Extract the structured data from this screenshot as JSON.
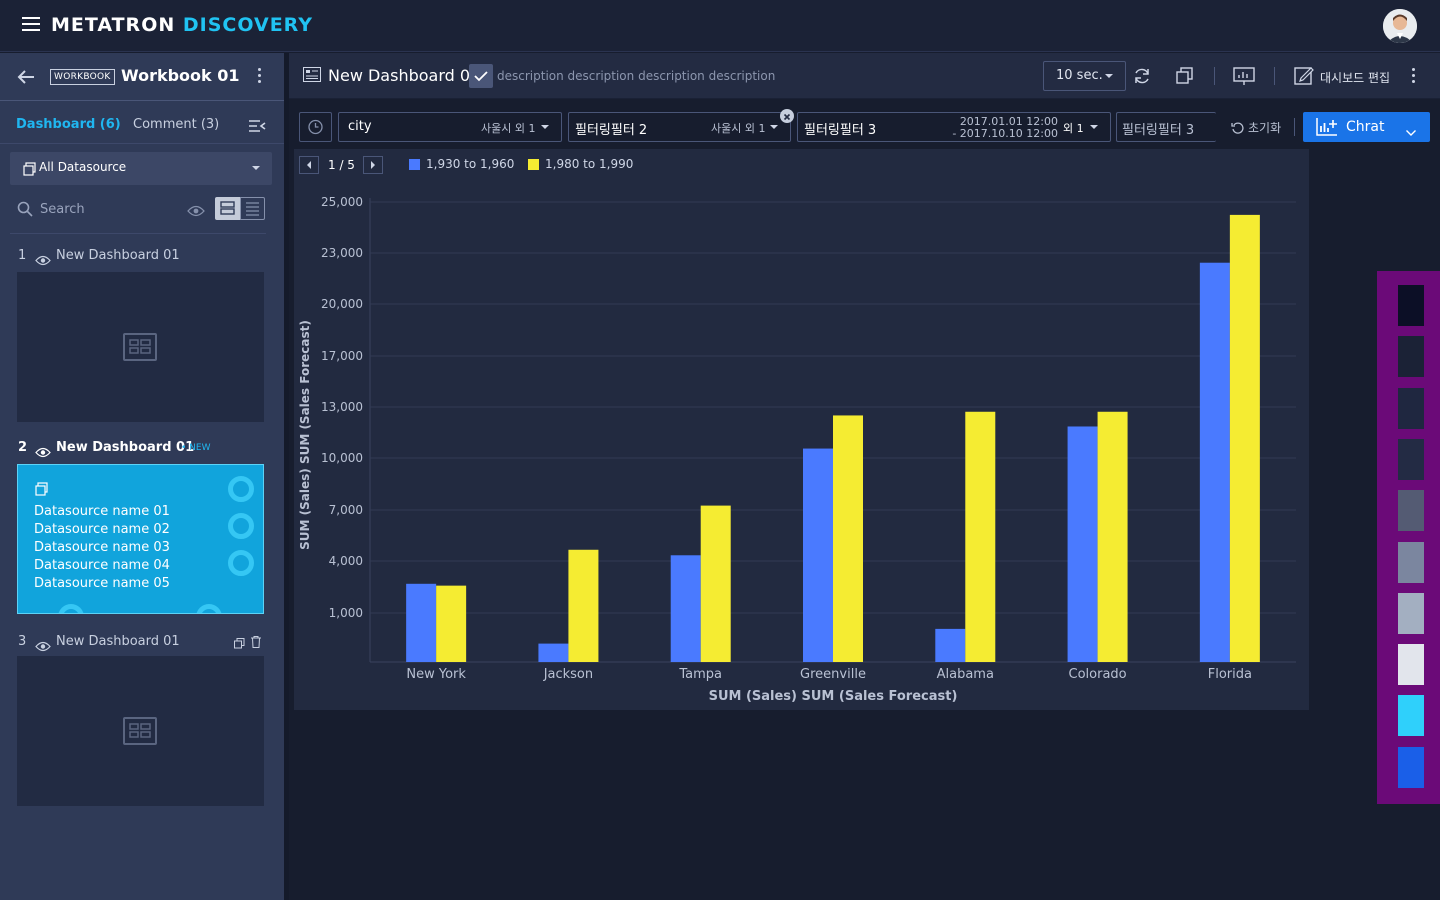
{
  "app": {
    "logo_main": "METATRON",
    "logo_accent": "DISCOVERY"
  },
  "workbook": {
    "badge": "WORKBOOK",
    "title": "Workbook 01"
  },
  "tabs": {
    "dashboard": "Dashboard (6)",
    "comment": "Comment (3)"
  },
  "datasource_select": {
    "label": "All Datasource"
  },
  "search": {
    "placeholder": "Search"
  },
  "dashboards": [
    {
      "num": "1",
      "name": "New Dashboard 01"
    },
    {
      "num": "2",
      "name": "New Dashboard 01",
      "badge": "NEW",
      "datasources": [
        "Datasource name 01",
        "Datasource name 02",
        "Datasource name 03",
        "Datasource name 04",
        "Datasource name 05"
      ]
    },
    {
      "num": "3",
      "name": "New Dashboard 01"
    }
  ],
  "header": {
    "title": "New Dashboard 01",
    "description": "description description description description",
    "refresh": "10 sec.",
    "edit_label": "대시보드 편집"
  },
  "filters": [
    {
      "label": "city",
      "value": "사울시 외 1"
    },
    {
      "label": "필터링필터 2",
      "value": "사울시 외 1"
    },
    {
      "label": "필터링필터 3",
      "date_from": "2017.01.01 12:00",
      "date_to": "- 2017.10.10 12:00",
      "value": "외 1"
    },
    {
      "label": "필터링필터 3"
    }
  ],
  "reset_label": "초기화",
  "chart_button": "Chrat",
  "pager": {
    "label": "1 / 5"
  },
  "chart_data": {
    "type": "bar",
    "categories": [
      "New York",
      "Jackson",
      "Tampa",
      "Greenville",
      "Alabama",
      "Colorado",
      "Florida"
    ],
    "series": [
      {
        "name": "1,930 to 1,960",
        "color": "#4a7aff",
        "values": [
          4250,
          1000,
          5800,
          11600,
          1800,
          12800,
          21700
        ]
      },
      {
        "name": "1,980 to 1,990",
        "color": "#f5ec32",
        "values": [
          4150,
          6100,
          8500,
          13400,
          13600,
          13600,
          24300
        ]
      }
    ],
    "y_ticks": [
      "25,000",
      "23,000",
      "20,000",
      "17,000",
      "13,000",
      "10,000",
      "7,000",
      "4,000",
      "1,000"
    ],
    "xlabel": "SUM (Sales)  SUM (Sales Forecast)",
    "ylabel": "SUM (Sales)  SUM (Sales Forecast)",
    "ylim": [
      0,
      25000
    ],
    "grid": true,
    "legend_position": "top-left"
  },
  "palette": [
    "#0c0f26",
    "#1b2236",
    "#1f2740",
    "#232b44",
    "#545b73",
    "#7b869f",
    "#a3afc1",
    "#e2e5ec",
    "#2fd0fb",
    "#1a5fe8"
  ]
}
